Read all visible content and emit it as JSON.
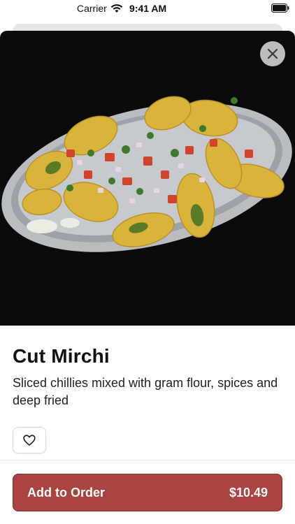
{
  "status_bar": {
    "carrier": "Carrier",
    "time": "9:41 AM",
    "icons": [
      "wifi-icon",
      "battery-icon"
    ]
  },
  "hero": {
    "image_subject": "plate of cut mirchi fritters topped with onions, tomatoes and cilantro",
    "close_icon": "close-icon"
  },
  "item": {
    "title": "Cut Mirchi",
    "description": "Sliced chillies mixed with gram flour, spices and deep fried",
    "favorite_icon": "heart-icon"
  },
  "order_button": {
    "label": "Add to Order",
    "price": "$10.49"
  },
  "colors": {
    "accent": "#a94442",
    "hero_background": "#0b0b0b",
    "close_button": "#bdbdbd"
  }
}
